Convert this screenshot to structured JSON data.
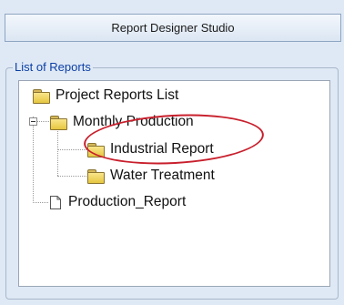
{
  "window": {
    "title": "Report Designer Studio"
  },
  "reports_group": {
    "legend": "List of Reports"
  },
  "tree": {
    "root": {
      "label": "Project Reports List",
      "icon": "folder-icon"
    },
    "monthly": {
      "label": "Monthly Production",
      "icon": "folder-icon",
      "expanded": true
    },
    "industrial": {
      "label": "Industrial Report",
      "icon": "folder-icon"
    },
    "water": {
      "label": "Water Treatment",
      "icon": "folder-icon"
    },
    "production": {
      "label": "Production_Report",
      "icon": "document-icon"
    }
  },
  "annotation": {
    "highlight_color": "#c81f2c"
  }
}
